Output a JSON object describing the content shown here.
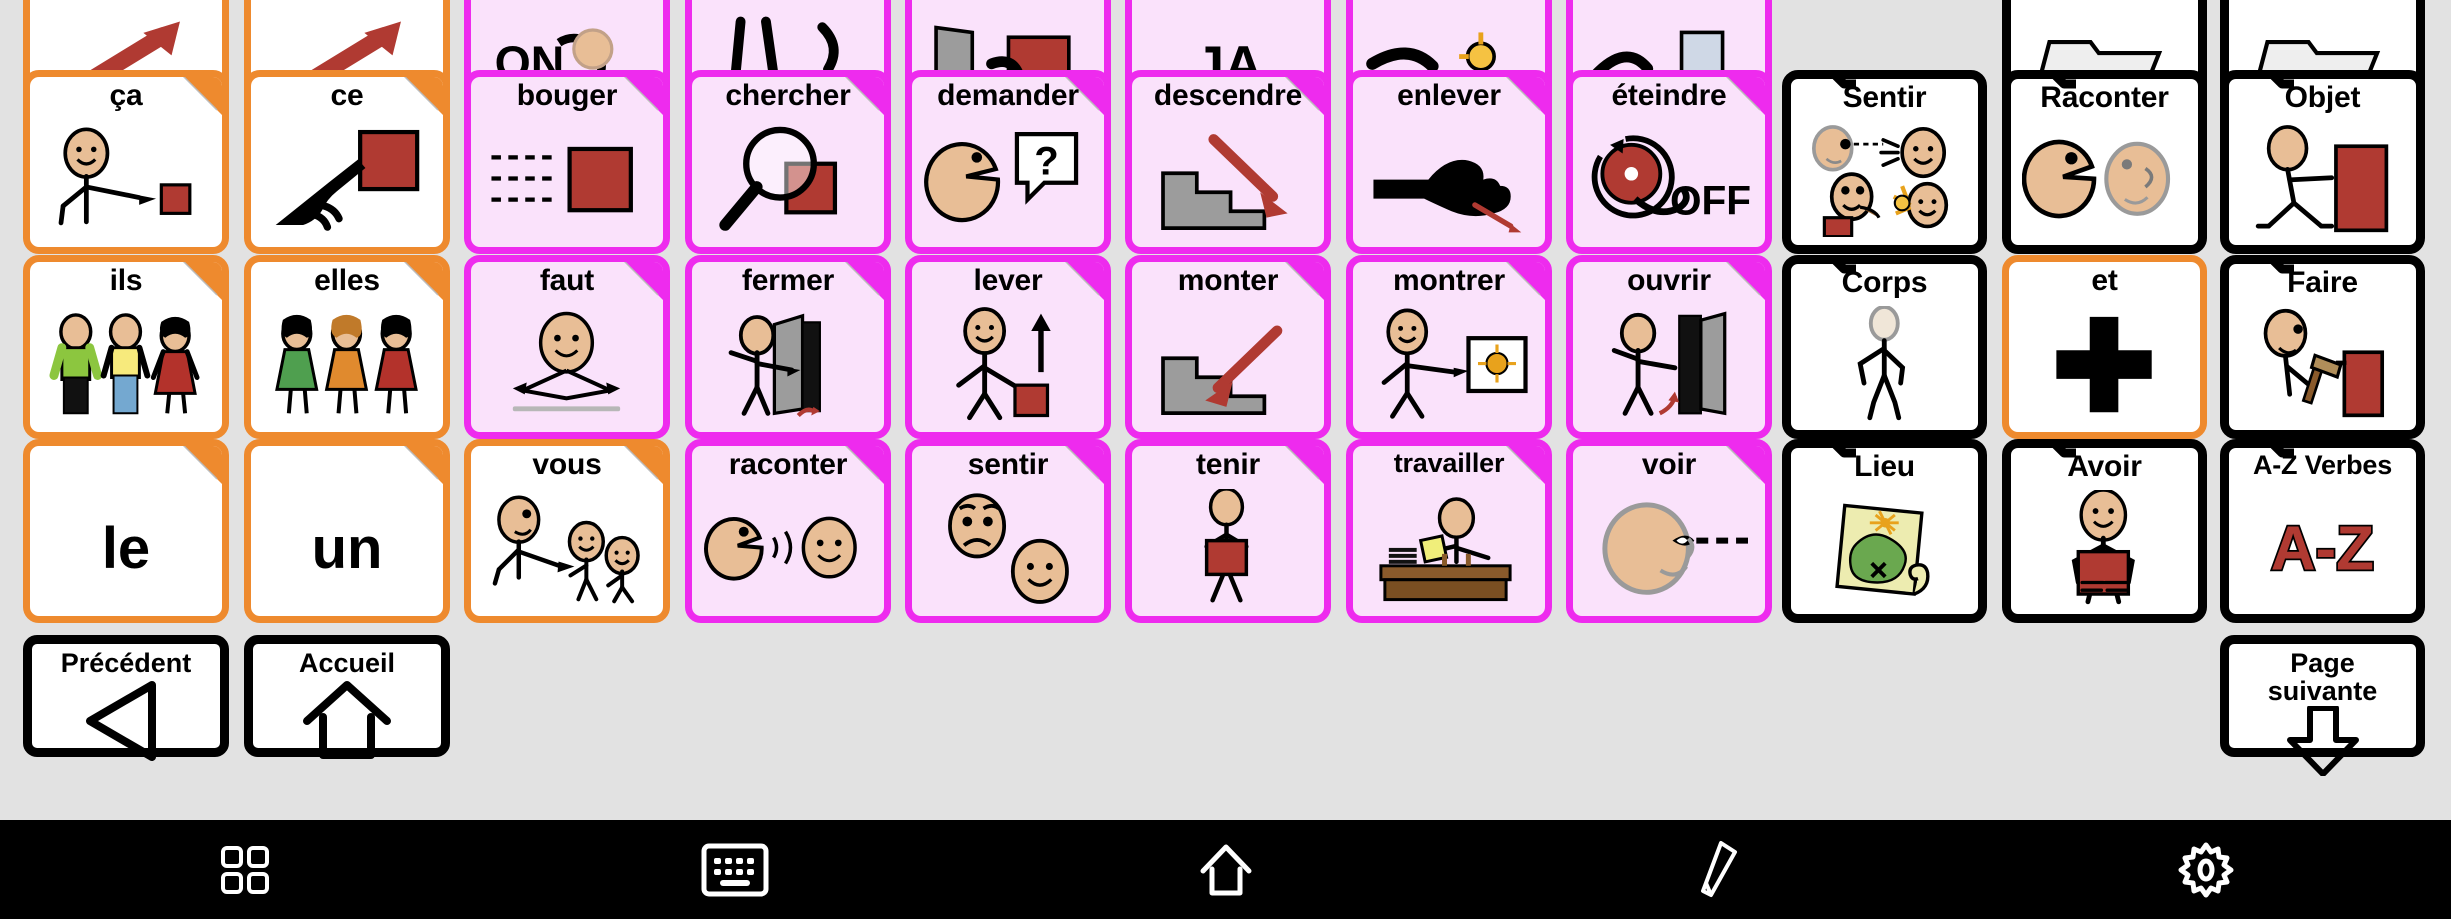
{
  "app": {
    "type": "aac-communication-board",
    "language": "fr",
    "background_color": "#e2e2e2",
    "colors": {
      "orange_border": "#ee8a2e",
      "pink_border": "#ee2bee",
      "pink_fill": "#fae2fb",
      "black_border": "#000000",
      "toolbar_background": "#000000",
      "toolbar_icon": "#ffffff",
      "skin": "#e8be96",
      "red_object": "#b03a32",
      "grey_stairs": "#9c9c9c"
    }
  },
  "grid": {
    "columns": 11,
    "visible_rows": 4,
    "top_row_clipped": true
  },
  "top_clipped_row": [
    {
      "label": "",
      "style": "orange",
      "icon": "red-arrow-up-right-icon"
    },
    {
      "label": "",
      "style": "orange",
      "icon": "red-arrow-up-right-icon"
    },
    {
      "label": "",
      "style": "pink",
      "icon": "on-switch-icon"
    },
    {
      "label": "",
      "style": "pink",
      "icon": "legs-walking-icon"
    },
    {
      "label": "",
      "style": "pink",
      "icon": "hand-door-icon"
    },
    {
      "label": "",
      "style": "pink",
      "icon": "letters-ja-icon"
    },
    {
      "label": "",
      "style": "pink",
      "icon": "hand-flower-icon"
    },
    {
      "label": "",
      "style": "pink",
      "icon": "hand-spray-icon"
    },
    {
      "label": "",
      "style": "black",
      "icon": "folder-icon"
    },
    {
      "label": "",
      "style": "black",
      "icon": "folder-icon"
    }
  ],
  "rows": [
    {
      "row_index": 1,
      "cells": [
        {
          "label": "ça",
          "style": "orange",
          "dogear": true,
          "icon": "person-pointing-at-small-red-square-icon"
        },
        {
          "label": "ce",
          "style": "orange",
          "dogear": true,
          "icon": "hand-pointing-at-red-square-icon"
        },
        {
          "label": "bouger",
          "style": "pink",
          "dogear": true,
          "icon": "dashed-lines-red-square-moving-icon"
        },
        {
          "label": "chercher",
          "style": "pink",
          "dogear": true,
          "icon": "magnifying-glass-over-red-square-icon"
        },
        {
          "label": "demander",
          "style": "pink",
          "dogear": true,
          "icon": "head-speaking-question-mark-icon"
        },
        {
          "label": "descendre",
          "style": "pink",
          "dogear": true,
          "icon": "stairs-with-down-arrow-icon"
        },
        {
          "label": "enlever",
          "style": "pink",
          "dogear": true,
          "icon": "hand-removing-object-icon"
        },
        {
          "label": "éteindre",
          "style": "pink",
          "dogear": true,
          "icon": "hand-turning-off-switch-icon"
        },
        {
          "label": "Sentir",
          "style": "black",
          "dogear": false,
          "icon": "faces-senses-icon"
        },
        {
          "label": "Raconter",
          "style": "black",
          "dogear": false,
          "icon": "two-faces-talking-listening-icon"
        },
        {
          "label": "Objet",
          "style": "black",
          "dogear": false,
          "icon": "person-pushing-red-box-icon"
        }
      ]
    },
    {
      "row_index": 2,
      "cells": [
        {
          "label": "ils",
          "style": "orange",
          "dogear": true,
          "icon": "three-people-group-male-icon"
        },
        {
          "label": "elles",
          "style": "orange",
          "dogear": true,
          "icon": "three-people-group-female-icon"
        },
        {
          "label": "faut",
          "style": "pink",
          "dogear": true,
          "icon": "head-with-arrows-obligation-icon"
        },
        {
          "label": "fermer",
          "style": "pink",
          "dogear": true,
          "icon": "person-closing-door-icon"
        },
        {
          "label": "lever",
          "style": "pink",
          "dogear": true,
          "icon": "person-lifting-red-box-up-arrow-icon"
        },
        {
          "label": "monter",
          "style": "pink",
          "dogear": true,
          "icon": "stairs-with-up-arrow-icon"
        },
        {
          "label": "montrer",
          "style": "pink",
          "dogear": true,
          "icon": "person-pointing-at-picture-icon"
        },
        {
          "label": "ouvrir",
          "style": "pink",
          "dogear": true,
          "icon": "person-opening-door-icon"
        },
        {
          "label": "Corps",
          "style": "black",
          "dogear": false,
          "icon": "body-stick-figure-icon"
        },
        {
          "label": "et",
          "style": "orange",
          "dogear": false,
          "icon": "black-plus-sign-icon"
        },
        {
          "label": "Faire",
          "style": "black",
          "dogear": false,
          "icon": "person-hammering-red-box-icon"
        }
      ]
    },
    {
      "row_index": 3,
      "cells": [
        {
          "label": "le",
          "style": "orange",
          "dogear": true,
          "icon": "text-only",
          "big_text": "le"
        },
        {
          "label": "un",
          "style": "orange",
          "dogear": true,
          "icon": "text-only",
          "big_text": "un"
        },
        {
          "label": "vous",
          "style": "orange",
          "dogear": true,
          "icon": "person-pointing-at-two-people-icon"
        },
        {
          "label": "raconter",
          "style": "pink",
          "dogear": true,
          "icon": "face-telling-to-face-icon"
        },
        {
          "label": "sentir",
          "style": "pink",
          "dogear": true,
          "icon": "two-faces-sad-happy-icon"
        },
        {
          "label": "tenir",
          "style": "pink",
          "dogear": true,
          "icon": "person-holding-red-box-icon"
        },
        {
          "label": "travailler",
          "style": "pink",
          "dogear": true,
          "icon": "person-at-desk-working-icon"
        },
        {
          "label": "voir",
          "style": "pink",
          "dogear": true,
          "icon": "head-with-eye-line-of-sight-icon"
        },
        {
          "label": "Lieu",
          "style": "black",
          "dogear": false,
          "icon": "treasure-map-icon"
        },
        {
          "label": "Avoir",
          "style": "black",
          "dogear": false,
          "icon": "person-holding-red-square-possession-icon"
        },
        {
          "label": "A-Z Verbes",
          "style": "black",
          "dogear": false,
          "icon": "a-z-letters-icon",
          "big_text": "A-Z"
        }
      ]
    }
  ],
  "navigation": {
    "back": {
      "label": "Précédent",
      "icon": "left-triangle-icon"
    },
    "home": {
      "label": "Accueil",
      "icon": "house-icon"
    },
    "next": {
      "label": "Page\nsuivante",
      "label_line1": "Page",
      "label_line2": "suivante",
      "icon": "down-arrow-icon"
    }
  },
  "toolbar": {
    "items": [
      {
        "name": "grid-icon",
        "label": "Grille"
      },
      {
        "name": "keyboard-icon",
        "label": "Clavier"
      },
      {
        "name": "home-icon",
        "label": "Accueil"
      },
      {
        "name": "pencil-icon",
        "label": "Modifier"
      },
      {
        "name": "gear-icon",
        "label": "Réglages"
      }
    ]
  }
}
